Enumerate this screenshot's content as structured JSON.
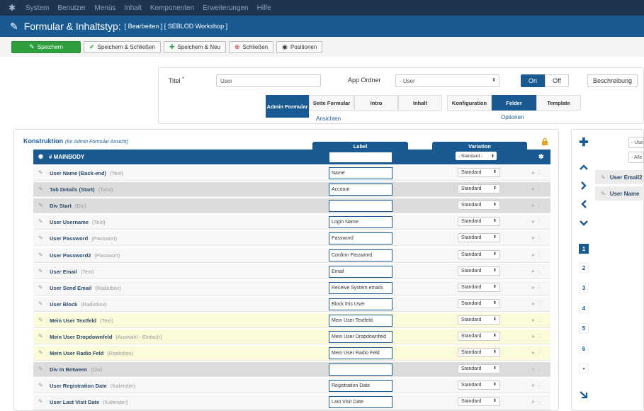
{
  "nav": {
    "items": [
      "System",
      "Benutzer",
      "Menüs",
      "Inhalt",
      "Komponenten",
      "Erweiterungen",
      "Hilfe"
    ]
  },
  "header": {
    "title": "Formular & Inhaltstyp:",
    "subtitle": "[ Bearbeiten ] [ SEBLOD Workshop ]"
  },
  "toolbar": {
    "save": "Speichern",
    "save_close": "Speichern & Schließen",
    "save_new": "Speichern & Neu",
    "close": "Schließen",
    "positions": "Positionen"
  },
  "form": {
    "title_label": "Titel",
    "required_mark": "*",
    "title_value": "User",
    "app_label": "App Ordner",
    "app_value": "- User",
    "on": "On",
    "off": "Off",
    "desc_button": "Beschreibung",
    "views": [
      "Admin Formular",
      "Seite Formular",
      "Intro",
      "Inhalt"
    ],
    "views_label": "Ansichten",
    "options": [
      "Konfiguration",
      "Felder",
      "Template"
    ],
    "options_label": "Optionen"
  },
  "construction": {
    "title": "Konstruktion",
    "subtitle": "(für Admin Formular Ansicht)",
    "label_header": "Label",
    "variation_header": "Variation",
    "main": {
      "name": "# MAINBODY",
      "variation": "- Standard -"
    },
    "rows": [
      {
        "name": "User Name (Back-end)",
        "type": "(Text)",
        "label": "Name",
        "variation": "Standard",
        "bg": "#f7f7f7"
      },
      {
        "name": "Tab Details (Start)",
        "type": "(Tabs)",
        "label": "Account",
        "variation": "Standard",
        "bg": "#dcdcdc"
      },
      {
        "name": "Div Start",
        "type": "(Div)",
        "label": "",
        "variation": "Standard",
        "bg": "#dcdcdc"
      },
      {
        "name": "User Username",
        "type": "(Text)",
        "label": "Login Name",
        "variation": "Standard",
        "bg": "#f7f7f7"
      },
      {
        "name": "User Password",
        "type": "(Passwort)",
        "label": "Password",
        "variation": "Standard",
        "bg": "#f7f7f7"
      },
      {
        "name": "User Password2",
        "type": "(Passwort)",
        "label": "Confirm Password",
        "variation": "Standard",
        "bg": "#f7f7f7"
      },
      {
        "name": "User Email",
        "type": "(Text)",
        "label": "Email",
        "variation": "Standard",
        "bg": "#f7f7f7"
      },
      {
        "name": "User Send Email",
        "type": "(Radiobox)",
        "label": "Receive System emails",
        "variation": "Standard",
        "bg": "#f7f7f7"
      },
      {
        "name": "User Block",
        "type": "(Radiobox)",
        "label": "Block this User",
        "variation": "Standard",
        "bg": "#f7f7f7"
      },
      {
        "name": "Mein User Textfeld",
        "type": "(Text)",
        "label": "Mein User Textfeld",
        "variation": "Standard",
        "bg": "#fbfbd9"
      },
      {
        "name": "Mein User Dropdownfeld",
        "type": "(Auswahl - Einfach)",
        "label": "Mein User Dropdownfeld",
        "variation": "Standard",
        "bg": "#fbfbd9"
      },
      {
        "name": "Mein User Radio Feld",
        "type": "(Radiobox)",
        "label": "Mein User Radio Feld",
        "variation": "Standard",
        "bg": "#fbfbd9"
      },
      {
        "name": "Div In Between",
        "type": "(Div)",
        "label": "",
        "variation": "Standard",
        "bg": "#dcdcdc"
      },
      {
        "name": "User Registration Date",
        "type": "(Kalender)",
        "label": "Registration Date",
        "variation": "Standard",
        "bg": "#f7f7f7"
      },
      {
        "name": "User Last Visit Date",
        "type": "(Kalender)",
        "label": "Last Visit Date",
        "variation": "Standard",
        "bg": "#f7f7f7"
      }
    ]
  },
  "sidebar": {
    "filters": [
      "- Use",
      "- Alle"
    ],
    "fields": [
      "User Email2",
      "User Name"
    ],
    "positions": [
      "1",
      "2",
      "3",
      "4",
      "5",
      "6",
      "•"
    ]
  },
  "colors": {
    "navbar": "#1f3450",
    "titlebar": "#1a5a92",
    "success": "#2f9e3e",
    "highlight": "#fbfbd9"
  },
  "icons": {
    "logo": "joomla-logo-icon",
    "title": "pen-icon",
    "lock": "lock-icon"
  }
}
